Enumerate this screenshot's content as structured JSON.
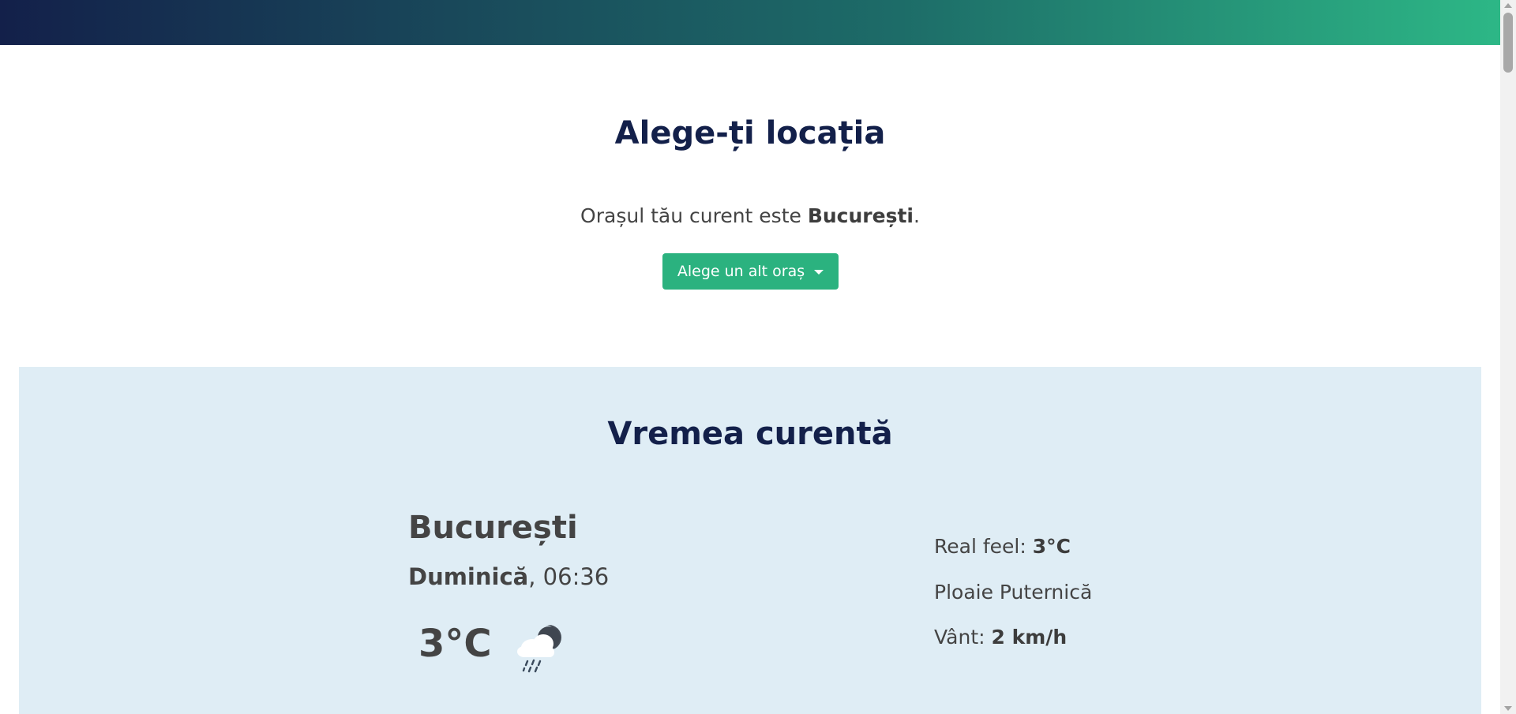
{
  "location": {
    "title": "Alege-ți locația",
    "current_prefix": "Orașul tău curent este ",
    "current_city": "București",
    "current_suffix": ".",
    "change_button": "Alege un alt oraș"
  },
  "weather": {
    "title": "Vremea curentă",
    "city": "București",
    "day": "Duminică",
    "time_text": ", 06:36",
    "temperature": "3°C",
    "icon": "cloud-rain-night-icon",
    "real_feel_label": "Real feel: ",
    "real_feel_value": "3°C",
    "condition": "Ploaie Puternică",
    "wind_label": "Vânt: ",
    "wind_value": "2 km/h"
  },
  "colors": {
    "accent": "#2bb27f",
    "heading": "#13204a",
    "weather_bg": "#dfedf5",
    "gradient_start": "#13204a",
    "gradient_end": "#2db786"
  }
}
